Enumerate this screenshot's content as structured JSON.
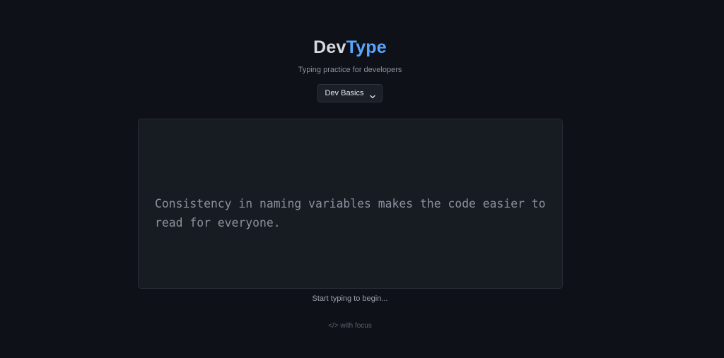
{
  "header": {
    "title_part_a": "Dev",
    "title_part_b": "Type",
    "subtitle": "Typing practice for developers"
  },
  "mode_select": {
    "selected": "Dev Basics"
  },
  "typing": {
    "prompt_text": "Consistency in naming variables makes the code easier to read for everyone."
  },
  "status": {
    "text": "Start typing to begin..."
  },
  "footer": {
    "text": "</> with focus"
  },
  "colors": {
    "background": "#0e1117",
    "accent": "#58a6ff",
    "panel": "#171b22"
  },
  "icons": {
    "select_chevron": "chevron-down-icon"
  }
}
